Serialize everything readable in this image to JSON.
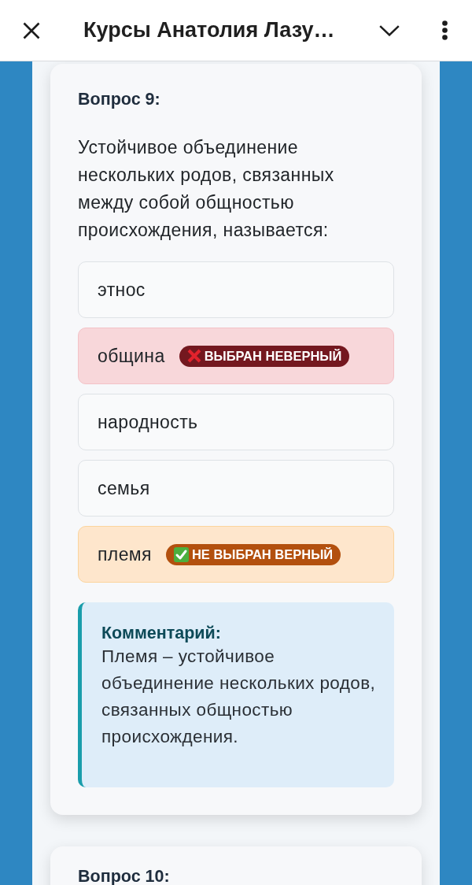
{
  "app_bar": {
    "title": "Курсы Анатолия Лазу…"
  },
  "questions": [
    {
      "title": "Вопрос 9:",
      "text": "Устойчивое объединение нескольких родов, связанных между собой общностью происхождения, называется:",
      "options": [
        {
          "label": "этнос",
          "selected": false,
          "correct": false
        },
        {
          "label": "община",
          "selected": true,
          "correct": false,
          "badge": "ВЫБРАН НЕВЕРНЫЙ"
        },
        {
          "label": "народность",
          "selected": false,
          "correct": false
        },
        {
          "label": "семья",
          "selected": false,
          "correct": false
        },
        {
          "label": "племя",
          "selected": false,
          "correct": true,
          "badge": "НЕ ВЫБРАН ВЕРНЫЙ"
        }
      ],
      "comment": {
        "title": "Комментарий:",
        "text": "Племя – устойчивое объединение нескольких родов, связанных общностью происхождения."
      }
    },
    {
      "title": "Вопрос 10:"
    }
  ]
}
